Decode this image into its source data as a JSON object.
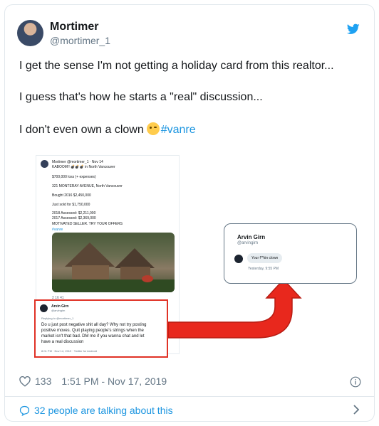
{
  "author": {
    "name": "Mortimer",
    "handle": "@mortimer_1"
  },
  "tweet": {
    "line1": "I get the sense I'm not getting a holiday card from this realtor...",
    "line2": "I guess that's how he starts a \"real\" discussion...",
    "line3": "I don't even own a clown",
    "hashtag": "#vanre"
  },
  "embedded": {
    "inner_tweet": {
      "header": "Mortimer @mortimer_1 · Nov 14",
      "line_kaboom": "KABOOM!! 💣💣💣 in North Vancouver",
      "line_loss": "$700,000 loss (+ expenses)",
      "line_address": "321 MONTERAY AVENUE, North Vancouver",
      "line_bought": "Bought 2016 $2,450,000",
      "line_sold": "Just sold for $1,750,000",
      "line_assessed_2018": "2018 Assessed: $2,211,000",
      "line_assessed_2017": "2017 Assessed: $2,369,000",
      "line_motivated": "MOTIVATED SELLER. TRY YOUR OFFERS",
      "line_tag": "#vanre",
      "actions": "2      16      41"
    },
    "reply": {
      "name": "Arvin Girn",
      "handle": "@arvingirn",
      "replying_to": "Replying to @mortimer_1",
      "body_1": "Do u just post negative shit all day? Why not try posting",
      "body_2": "positive moves. Quit playing people's strings when the",
      "body_3": "market isn't  that bad. DM me if you wanna chat and let",
      "body_4": "have a real discussion",
      "meta": "8:01 PM · Nov 14, 2019 · Twitter for Android"
    },
    "dm": {
      "name": "Arvin Girn",
      "handle": "@arvingirn",
      "message": "Your f**kin clown",
      "time": "Yesterday, 9:55 PM"
    }
  },
  "footer": {
    "likes": "133",
    "timestamp": "1:51 PM - Nov 17, 2019",
    "conversation": "32 people are talking about this"
  },
  "colors": {
    "link": "#1b95e0",
    "muted": "#657786",
    "highlight_red": "#e03226",
    "border": "#e1e8ed"
  },
  "icons": [
    "twitter-bird-icon",
    "heart-icon",
    "info-icon",
    "speech-bubble-icon",
    "chevron-right-icon"
  ]
}
